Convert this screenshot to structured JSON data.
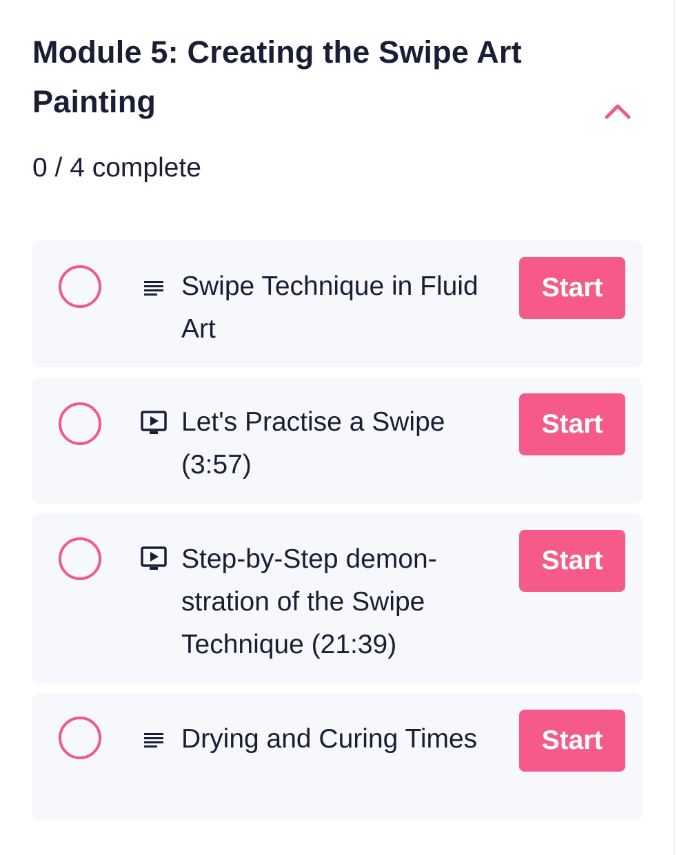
{
  "module": {
    "title": "Module 5: Creating the Swipe Art Painting",
    "progress_text": "0 / 4 complete",
    "collapse_icon": "chevron-up-icon",
    "accent_color": "#f55a8a"
  },
  "lessons": [
    {
      "title": "Swipe Technique in Fluid Art",
      "type_icon": "text-lesson-icon",
      "status": "not-started",
      "button_label": "Start"
    },
    {
      "title": "Let's Practise a Swipe (3:57)",
      "type_icon": "video-lesson-icon",
      "status": "not-started",
      "button_label": "Start"
    },
    {
      "title": "Step-by-Step demon-stration of the Swipe Technique (21:39)",
      "type_icon": "video-lesson-icon",
      "status": "not-started",
      "button_label": "Start"
    },
    {
      "title": "Drying and Curing Times",
      "type_icon": "text-lesson-icon",
      "status": "not-started",
      "button_label": "Start"
    }
  ]
}
